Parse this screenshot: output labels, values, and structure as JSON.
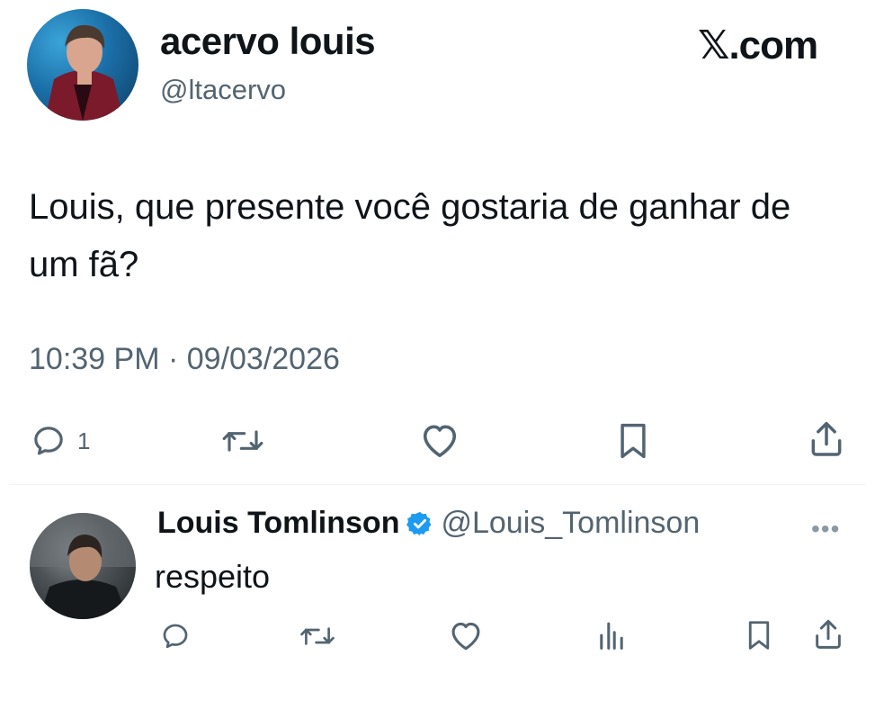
{
  "brand": {
    "label": "𝕏.com"
  },
  "tweet": {
    "author_name": "acervo louis",
    "author_handle": "@ltacervo",
    "text": "Louis, que presente você gostaria de ganhar de um fã?",
    "timestamp": "10:39 PM · 09/03/2026",
    "actions": {
      "reply_icon": "reply-icon",
      "reply_count": "1",
      "retweet_icon": "retweet-icon",
      "like_icon": "heart-icon",
      "bookmark_icon": "bookmark-icon",
      "share_icon": "share-icon"
    }
  },
  "reply": {
    "author_name": "Louis Tomlinson",
    "verified_icon": "verified-badge-icon",
    "author_handle": "@Louis_Tomlinson",
    "more_icon": "more-dots-icon",
    "text": "respeito",
    "actions": {
      "reply_icon": "reply-icon",
      "retweet_icon": "retweet-icon",
      "like_icon": "heart-icon",
      "views_icon": "views-icon",
      "bookmark_icon": "bookmark-icon",
      "share_icon": "share-icon"
    }
  },
  "colors": {
    "text": "#0f1419",
    "secondary": "#536471",
    "verified": "#1d9bf0",
    "divider": "#eff3f4"
  }
}
